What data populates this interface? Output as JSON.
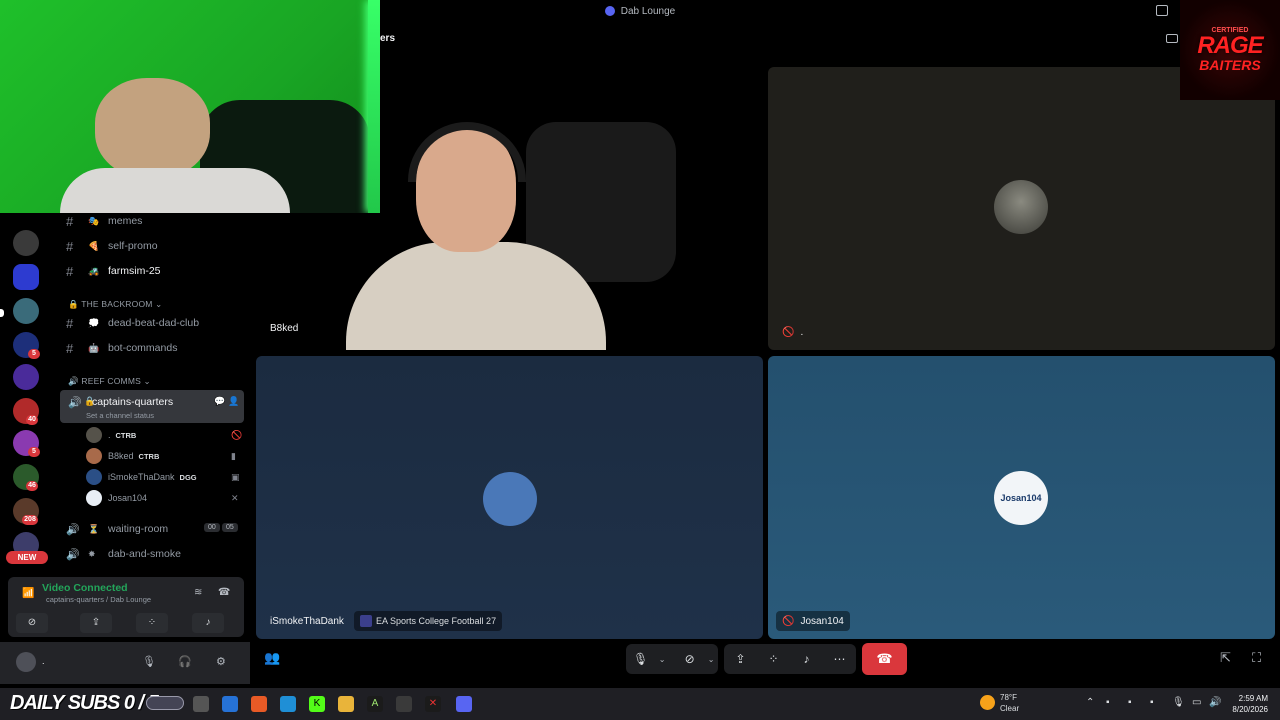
{
  "window": {
    "title": "Dab Lounge",
    "breadcrumb_tail": "ers"
  },
  "servers": [
    {
      "badge": ""
    },
    {
      "badge": ""
    },
    {
      "badge": ""
    },
    {
      "badge": "5"
    },
    {
      "badge": ""
    },
    {
      "badge": "40"
    },
    {
      "badge": "5"
    },
    {
      "badge": "46"
    },
    {
      "badge": "208"
    }
  ],
  "new_pill": "NEW",
  "channels": {
    "top": [
      {
        "name": "memes",
        "emoji": "🎭"
      },
      {
        "name": "self-promo",
        "emoji": "🍕"
      },
      {
        "name": "farmsim-25",
        "emoji": "🚜"
      }
    ],
    "backroom_label": "THE BACKROOM",
    "backroom": [
      {
        "name": "dead-beat-dad-club",
        "emoji": "💭"
      },
      {
        "name": "bot-commands",
        "emoji": "🤖"
      }
    ],
    "reef_label": "REEF COMMS",
    "active": {
      "name": "captains-quarters",
      "status": "Set a channel status"
    },
    "voice_users": [
      {
        "name": ".",
        "tag": "CTRB",
        "color": "#55524a"
      },
      {
        "name": "B8ked",
        "tag": "CTRB",
        "color": "#a86a4a"
      },
      {
        "name": "iSmokeThaDank",
        "tag": "DGG",
        "color": "#2b4f86"
      },
      {
        "name": "Josan104",
        "tag": "",
        "color": "#e8eef5"
      }
    ],
    "waiting_room": {
      "name": "waiting-room",
      "count_a": "00",
      "count_b": "05"
    },
    "dab_and_smoke": {
      "name": "dab-and-smoke"
    }
  },
  "voice_panel": {
    "status": "Video Connected",
    "location": "captains-quarters / Dab Lounge"
  },
  "user_panel": {
    "name": "."
  },
  "tiles": {
    "b8ked": {
      "name": "B8ked"
    },
    "dot": {
      "name": "."
    },
    "ismoke": {
      "name": "iSmokeThaDank",
      "game": "EA Sports College Football 27",
      "avatar_color": "#4a78b8"
    },
    "josan": {
      "name": "Josan104",
      "avatar_text": "Josan104"
    }
  },
  "logo": {
    "line1": "CERTIFIED",
    "line2": "RAGE",
    "line3": "BAITERS"
  },
  "taskbar": {
    "subs_text": "DAILY SUBS 0 / 5",
    "weather_temp": "78°F",
    "weather_desc": "Clear",
    "time": "2:59 AM",
    "date": "8/20/2026"
  },
  "colors": {
    "accent": "#5865f2",
    "danger": "#da373c",
    "connected": "#23a55a"
  }
}
